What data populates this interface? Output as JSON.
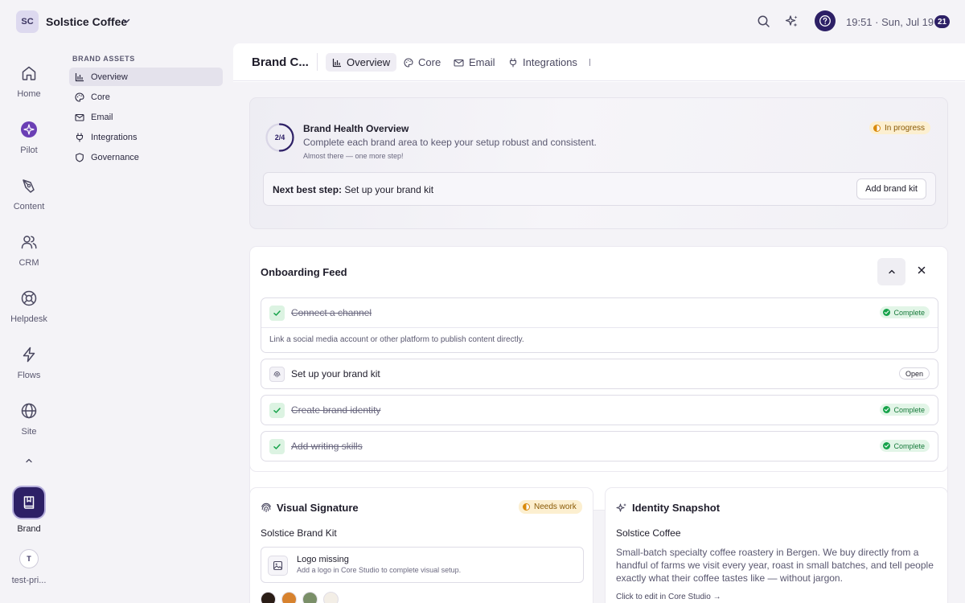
{
  "workspace": {
    "initials": "SC",
    "name": "Solstice Coffee"
  },
  "topbar": {
    "clock": "19:51 · Sun, Jul 19",
    "notification_count": "21"
  },
  "rail": {
    "items": [
      {
        "label": "Home"
      },
      {
        "label": "Pilot"
      },
      {
        "label": "Content"
      },
      {
        "label": "CRM"
      },
      {
        "label": "Helpdesk"
      },
      {
        "label": "Flows"
      },
      {
        "label": "Site"
      }
    ],
    "active": {
      "label": "Brand"
    },
    "user": {
      "initial": "T",
      "label": "test-pri..."
    }
  },
  "secondary_nav": {
    "heading": "BRAND ASSETS",
    "items": [
      {
        "label": "Overview",
        "icon": "bar-chart-icon"
      },
      {
        "label": "Core",
        "icon": "palette-icon"
      },
      {
        "label": "Email",
        "icon": "mail-icon"
      },
      {
        "label": "Integrations",
        "icon": "plug-icon"
      },
      {
        "label": "Governance",
        "icon": "shield-icon"
      }
    ]
  },
  "main": {
    "title": "Brand C...",
    "tabs": [
      {
        "label": "Overview"
      },
      {
        "label": "Core"
      },
      {
        "label": "Email"
      },
      {
        "label": "Integrations"
      }
    ]
  },
  "health": {
    "progress_text": "2/4",
    "progress": {
      "done": 2,
      "total": 4
    },
    "title": "Brand Health Overview",
    "subtitle": "Complete each brand area to keep your setup robust and consistent.",
    "hint": "Almost there — one more step!",
    "status": "In progress",
    "next_label": "Next best step:",
    "next_value": " Set up your brand kit",
    "next_button": "Add brand kit"
  },
  "feed": {
    "title": "Onboarding Feed",
    "tasks": [
      {
        "label": "Connect a channel",
        "status": "Complete",
        "description": "Link a social media account or other platform to publish content directly."
      },
      {
        "label": "Set up your brand kit",
        "status": "Open"
      },
      {
        "label": "Create brand identity",
        "status": "Complete"
      },
      {
        "label": "Add writing skills",
        "status": "Complete"
      }
    ]
  },
  "visual": {
    "title": "Visual Signature",
    "status": "Needs work",
    "kit_name": "Solstice Brand Kit",
    "logo_title": "Logo missing",
    "logo_sub": "Add a logo in Core Studio to complete visual setup.",
    "swatches": [
      "#2a1d16",
      "#d7822e",
      "#7a8f68",
      "#f3eee6"
    ]
  },
  "identity": {
    "title": "Identity Snapshot",
    "name": "Solstice Coffee",
    "description": "Small-batch specialty coffee roastery in Bergen. We buy directly from a handful of farms we visit every year, roast in small batches, and tell people exactly what their coffee tastes like — without jargon.",
    "link": "Click to edit in Core Studio →"
  },
  "colors": {
    "accent": "#2d2066",
    "complete": "#16a34a",
    "warning": "#d98a0b"
  }
}
